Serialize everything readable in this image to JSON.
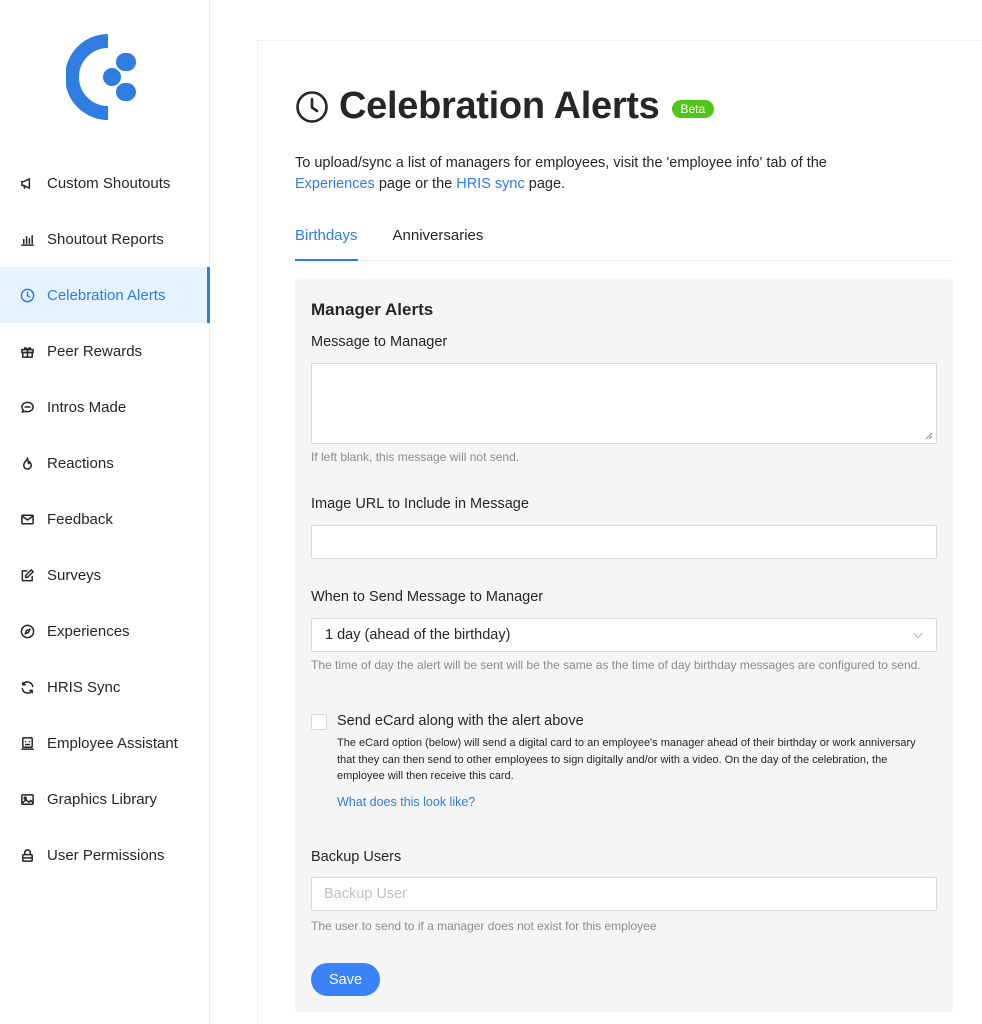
{
  "sidebar": {
    "brand_color": "#2f7de1",
    "items": [
      {
        "label": "Custom Shoutouts",
        "icon": "megaphone-icon",
        "active": false
      },
      {
        "label": "Shoutout Reports",
        "icon": "bar-chart-icon",
        "active": false
      },
      {
        "label": "Celebration Alerts",
        "icon": "clock-icon",
        "active": true
      },
      {
        "label": "Peer Rewards",
        "icon": "gift-icon",
        "active": false
      },
      {
        "label": "Intros Made",
        "icon": "chat-icon",
        "active": false
      },
      {
        "label": "Reactions",
        "icon": "fire-icon",
        "active": false
      },
      {
        "label": "Feedback",
        "icon": "mail-icon",
        "active": false
      },
      {
        "label": "Surveys",
        "icon": "edit-icon",
        "active": false
      },
      {
        "label": "Experiences",
        "icon": "compass-icon",
        "active": false
      },
      {
        "label": "HRIS Sync",
        "icon": "sync-icon",
        "active": false
      },
      {
        "label": "Employee Assistant",
        "icon": "assistant-icon",
        "active": false
      },
      {
        "label": "Graphics Library",
        "icon": "image-icon",
        "active": false
      },
      {
        "label": "User Permissions",
        "icon": "lock-icon",
        "active": false
      }
    ]
  },
  "header": {
    "title": "Celebration Alerts",
    "badge": "Beta",
    "intro_prefix": "To upload/sync a list of managers for employees, visit the 'employee info' tab of the",
    "intro_link1": "Experiences",
    "intro_middle": "page or the",
    "intro_link2": "HRIS sync",
    "intro_suffix": "page."
  },
  "tabs": [
    {
      "label": "Birthdays",
      "active": true
    },
    {
      "label": "Anniversaries",
      "active": false
    }
  ],
  "form": {
    "section_title": "Manager Alerts",
    "message_label": "Message to Manager",
    "message_value": "",
    "message_help": "If left blank, this message will not send.",
    "image_label": "Image URL to Include in Message",
    "image_value": "",
    "when_label": "When to Send Message to Manager",
    "when_value": "1 day (ahead of the birthday)",
    "when_help": "The time of day the alert will be sent will be the same as the time of day birthday messages are configured to send.",
    "ecard_label": "Send eCard along with the alert above",
    "ecard_checked": false,
    "ecard_desc": "The eCard option (below) will send a digital card to an employee's manager ahead of their birthday or work anniversary that they can then send to other employees to sign digitally and/or with a video. On the day of the celebration, the employee will then receive this card.",
    "ecard_link": "What does this look like?",
    "backup_label": "Backup Users",
    "backup_placeholder": "Backup User",
    "backup_help": "The user to send to if a manager does not exist for this employee",
    "save_label": "Save"
  },
  "colors": {
    "accent": "#2f7de1",
    "badge": "#52c41a",
    "button": "#3b82f6",
    "card_bg": "#f5f5f5"
  }
}
